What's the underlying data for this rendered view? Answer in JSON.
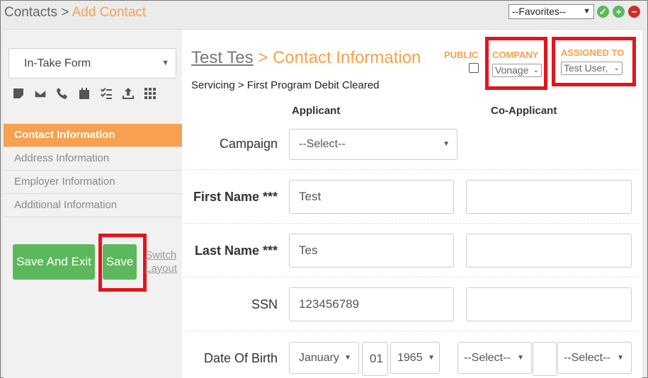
{
  "header": {
    "breadcrumb_root": "Contacts",
    "breadcrumb_sep": ">",
    "breadcrumb_current": "Add Contact",
    "favorites_value": "--Favorites--"
  },
  "sidebar": {
    "form_select_value": "In-Take Form",
    "icons": [
      "note-icon",
      "mail-icon",
      "phone-icon",
      "calendar-icon",
      "checklist-icon",
      "upload-icon",
      "grid-icon"
    ],
    "nav": [
      {
        "label": "Contact Information",
        "active": true
      },
      {
        "label": "Address Information",
        "active": false
      },
      {
        "label": "Employer Information",
        "active": false
      },
      {
        "label": "Additional Information",
        "active": false
      }
    ],
    "save_exit_label": "Save And Exit",
    "save_label": "Save",
    "switch_line1": "Switch",
    "switch_line2": "Layout"
  },
  "main": {
    "contact_name": "Test Tes",
    "title_suffix": "> Contact Information",
    "public_label": "PUBLIC",
    "company_label": "COMPANY",
    "company_value": "Vonage",
    "assigned_label": "ASSIGNED TO",
    "assigned_value": "Test User,",
    "status_line": "Servicing > First Program Debit Cleared",
    "col_applicant": "Applicant",
    "col_coapplicant": "Co-Applicant",
    "fields": {
      "campaign_label": "Campaign",
      "campaign_value": "--Select--",
      "first_name_label": "First Name ***",
      "first_name_value": "Test",
      "first_name_co_value": "",
      "last_name_label": "Last Name ***",
      "last_name_value": "Tes",
      "last_name_co_value": "",
      "ssn_label": "SSN",
      "ssn_value": "123456789",
      "ssn_co_value": "",
      "dob_label": "Date Of Birth",
      "dob_month": "January",
      "dob_day": "01",
      "dob_year": "1965",
      "dob_co_month": "--Select--",
      "dob_co_day": "",
      "dob_co_year": "--Select--"
    }
  },
  "colors": {
    "accent": "#f7a04f",
    "success": "#5cb85c",
    "danger": "#c9302c",
    "highlight": "#e4141c"
  }
}
